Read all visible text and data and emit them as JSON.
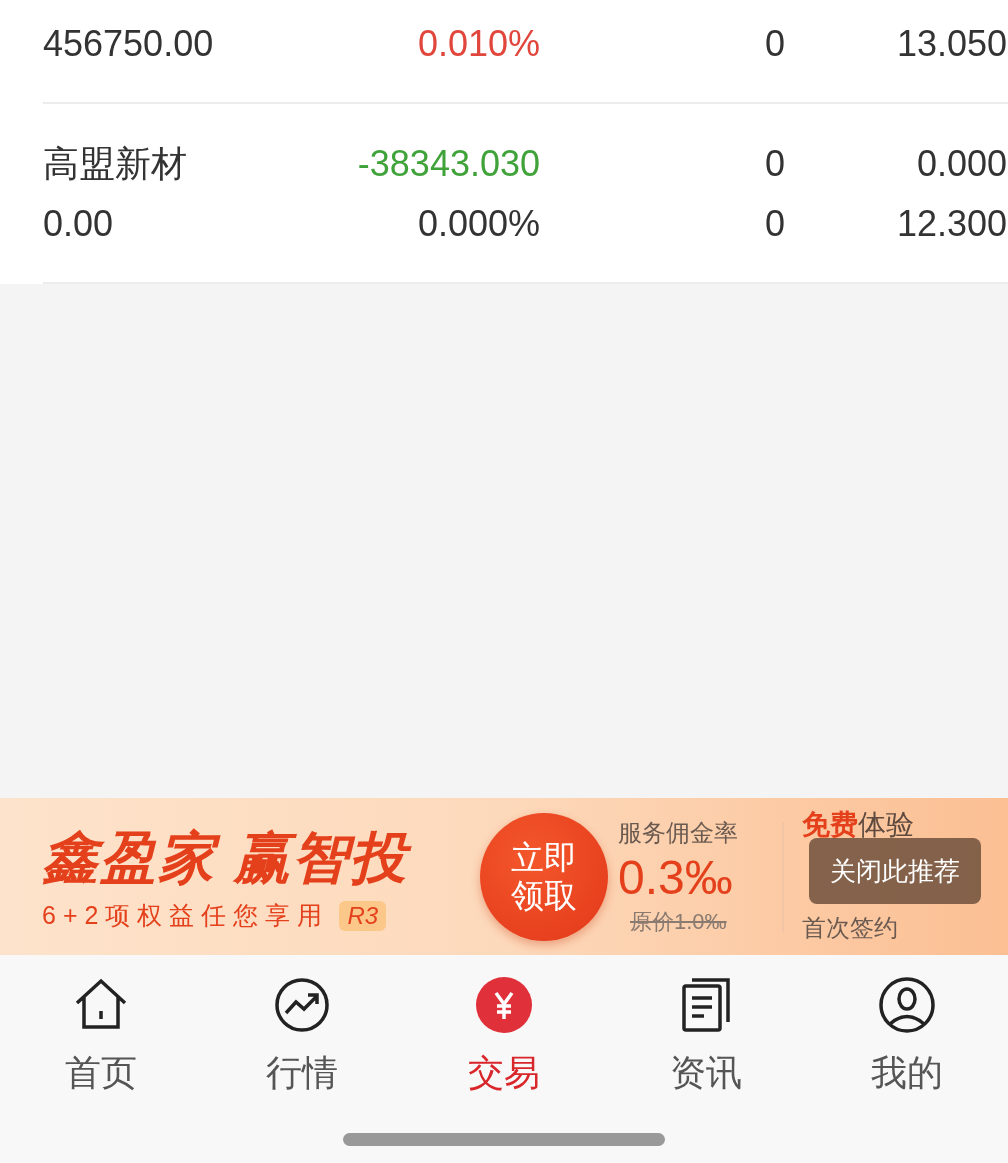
{
  "positions": [
    {
      "lines": [
        [
          {
            "text": "456750.00",
            "color": "#333333"
          },
          {
            "text": "0.010%",
            "color": "#e0463c"
          },
          {
            "text": "0",
            "color": "#333333"
          },
          {
            "text": "13.050",
            "color": "#333333"
          }
        ]
      ]
    },
    {
      "lines": [
        [
          {
            "text": "高盟新材",
            "color": "#333333"
          },
          {
            "text": "-38343.030",
            "color": "#3fa33a"
          },
          {
            "text": "0",
            "color": "#333333"
          },
          {
            "text": "0.000",
            "color": "#333333"
          }
        ],
        [
          {
            "text": "0.00",
            "color": "#333333"
          },
          {
            "text": "0.000%",
            "color": "#333333"
          },
          {
            "text": "0",
            "color": "#333333"
          },
          {
            "text": "12.300",
            "color": "#333333"
          }
        ]
      ]
    }
  ],
  "banner": {
    "title": "鑫盈家 赢智投",
    "subtitle": "6+2项权益任您享用",
    "risk_badge": "R3",
    "cta_line1": "立即",
    "cta_line2": "领取",
    "rate_label": "服务佣金率",
    "rate": "0.3‰",
    "original_price": "原价1.0‰",
    "free_label": "**免费**体验",
    "first_sign": "首次签约",
    "close_button": "关闭此推荐"
  },
  "tabs": [
    {
      "label": "首页",
      "selected": false
    },
    {
      "label": "行情",
      "selected": false
    },
    {
      "label": "交易",
      "selected": true
    },
    {
      "label": "资讯",
      "selected": false
    },
    {
      "label": "我的",
      "selected": false
    }
  ]
}
